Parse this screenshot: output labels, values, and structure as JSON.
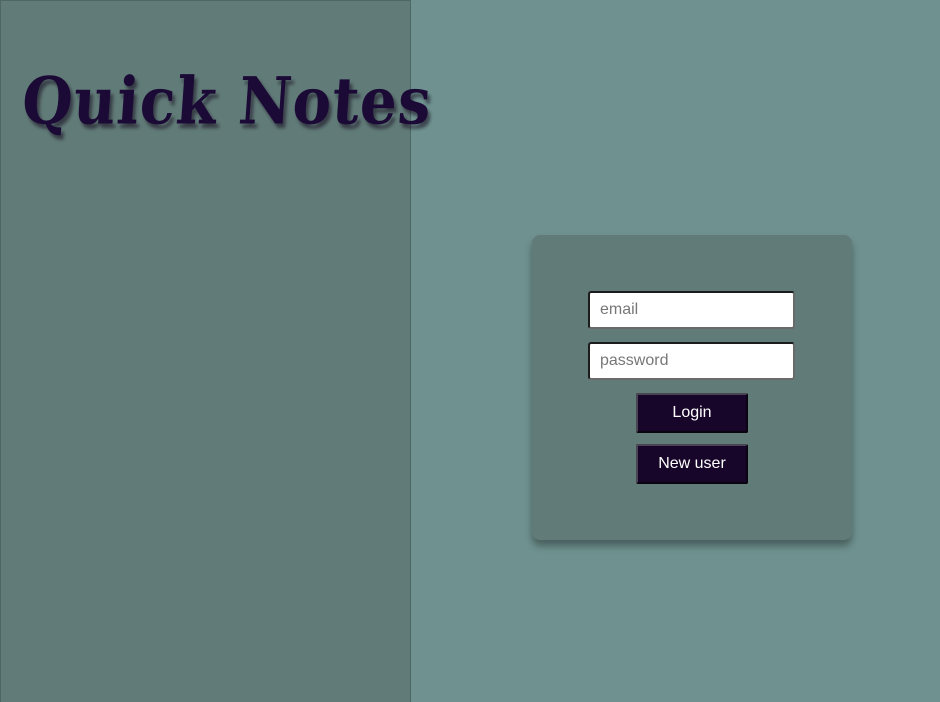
{
  "app": {
    "title": "Quick Notes"
  },
  "login_form": {
    "email": {
      "placeholder": "email",
      "value": ""
    },
    "password": {
      "placeholder": "password",
      "value": ""
    },
    "login_label": "Login",
    "new_user_label": "New user"
  },
  "colors": {
    "background": "#6f9290",
    "panel": "#617b78",
    "title_text": "#1b0a35",
    "button": "#170629"
  }
}
